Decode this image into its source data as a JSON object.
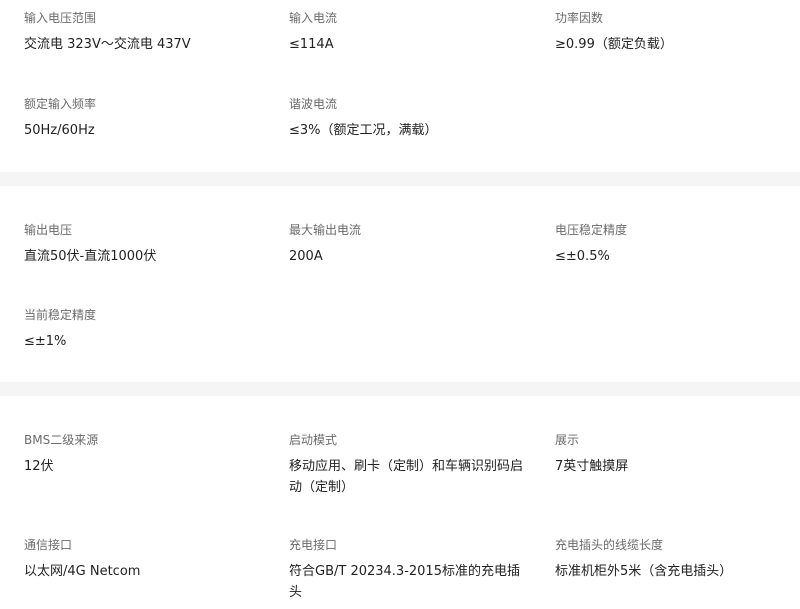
{
  "sections": [
    {
      "items": [
        {
          "label": "输入电压范围",
          "value": "交流电 323V～交流电 437V"
        },
        {
          "label": "输入电流",
          "value": "≤114A"
        },
        {
          "label": "功率因数",
          "value": "≥0.99（额定负载）"
        },
        {
          "label": "额定输入频率",
          "value": "50Hz/60Hz"
        },
        {
          "label": "谐波电流",
          "value": "≤3%（额定工况，满载）"
        }
      ]
    },
    {
      "items": [
        {
          "label": "输出电压",
          "value": "直流50伏-直流1000伏"
        },
        {
          "label": "最大输出电流",
          "value": "200A"
        },
        {
          "label": "电压稳定精度",
          "value": "≤±0.5%"
        },
        {
          "label": "当前稳定精度",
          "value": "≤±1%"
        }
      ]
    },
    {
      "items": [
        {
          "label": "BMS二级来源",
          "value": "12伏"
        },
        {
          "label": "启动模式",
          "value": "移动应用、刷卡（定制）和车辆识别码启动（定制）"
        },
        {
          "label": "展示",
          "value": "7英寸触摸屏"
        },
        {
          "label": "通信接口",
          "value": "以太网/4G Netcom"
        },
        {
          "label": "充电接口",
          "value": "符合GB/T 20234.3-2015标准的充电插头"
        },
        {
          "label": "充电插头的线缆长度",
          "value": "标准机柜外5米（含充电插头）"
        }
      ]
    }
  ]
}
